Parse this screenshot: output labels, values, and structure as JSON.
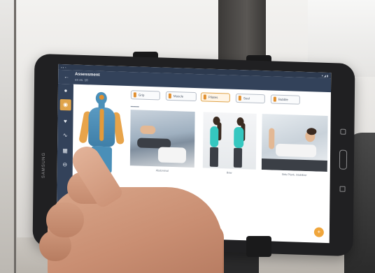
{
  "app_bar": {
    "title": "Assessment",
    "subtitle": "en es. 10"
  },
  "nav_rail": [
    {
      "icon": "profile-icon",
      "glyph": "●"
    },
    {
      "icon": "body-icon",
      "glyph": "⬤",
      "active": true
    },
    {
      "icon": "heart-icon",
      "glyph": "♥"
    },
    {
      "icon": "activity-icon",
      "glyph": "〰"
    },
    {
      "icon": "calendar-icon",
      "glyph": "▦"
    },
    {
      "icon": "toggle-icon",
      "glyph": "⬬"
    }
  ],
  "filters": [
    {
      "label": "Grip"
    },
    {
      "label": "Muscle"
    },
    {
      "label": "Pilates",
      "active": true
    },
    {
      "label": "Soul"
    },
    {
      "label": "Bubble"
    }
  ],
  "cards": [
    {
      "caption": "Abdominal"
    },
    {
      "caption": "Bow"
    },
    {
      "caption": "Side Plank, Stabilizer"
    }
  ],
  "device": {
    "brand": "SAMSUNG"
  },
  "colors": {
    "app_bar": "#33425a",
    "accent": "#e0a44a",
    "body_model": "#4a8fb8",
    "fab": "#f0a63c"
  }
}
